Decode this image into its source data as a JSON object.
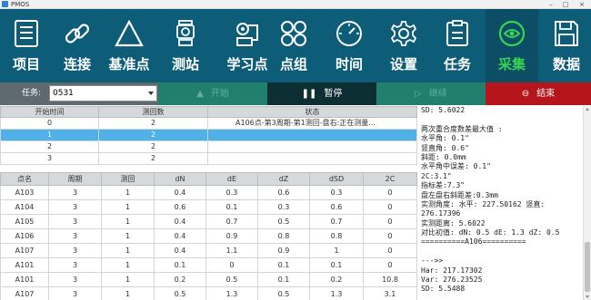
{
  "window": {
    "title": "PMOS"
  },
  "toolbar": {
    "items": [
      {
        "label": "项目",
        "icon": "list-icon"
      },
      {
        "label": "连接",
        "icon": "link-icon"
      },
      {
        "label": "基准点",
        "icon": "triangle-icon"
      },
      {
        "label": "测站",
        "icon": "total-station-icon"
      },
      {
        "label": "学习点",
        "icon": "learn-point-icon"
      },
      {
        "label": "点组",
        "icon": "point-group-icon"
      },
      {
        "label": "时间",
        "icon": "clock-icon"
      },
      {
        "label": "设置",
        "icon": "gear-icon"
      },
      {
        "label": "任务",
        "icon": "task-icon"
      },
      {
        "label": "采集",
        "icon": "collect-icon"
      },
      {
        "label": "数据",
        "icon": "save-icon"
      }
    ],
    "active_index": 9,
    "colors": {
      "background": "#0d5c78",
      "active_label": "#39d353"
    }
  },
  "controls": {
    "task_label": "任务:",
    "task_value": "0531",
    "start_label": "开始",
    "pause_label": "暂停",
    "continue_label": "继续",
    "end_label": "结束"
  },
  "rounds_table": {
    "headers": [
      "开始时间",
      "测回数",
      "状态"
    ],
    "rows": [
      [
        "0",
        "2",
        "A106点-第3周期-第1测回-盘右:正在测量..."
      ],
      [
        "1",
        "2",
        ""
      ],
      [
        "2",
        "2",
        ""
      ],
      [
        "3",
        "2",
        ""
      ]
    ],
    "selected_row": 1
  },
  "points_table": {
    "headers": [
      "点名",
      "周期",
      "测回",
      "dN",
      "dE",
      "dZ",
      "dSD",
      "2C"
    ],
    "rows": [
      [
        "A103",
        "3",
        "1",
        "0.4",
        "0.3",
        "0.6",
        "0.3",
        "0"
      ],
      [
        "A104",
        "3",
        "1",
        "0.6",
        "0.1",
        "0.3",
        "0.6",
        "0"
      ],
      [
        "A105",
        "3",
        "1",
        "0.4",
        "0.7",
        "0.5",
        "0.7",
        "0"
      ],
      [
        "A106",
        "3",
        "1",
        "0.4",
        "0.9",
        "0.8",
        "0.8",
        "0"
      ],
      [
        "A107",
        "3",
        "1",
        "0.4",
        "1.1",
        "0.9",
        "1",
        "0"
      ],
      [
        "A101",
        "3",
        "1",
        "0.1",
        "0",
        "0.1",
        "0.1",
        "0"
      ],
      [
        "A101",
        "3",
        "1",
        "0.2",
        "0.5",
        "0.1",
        "0.2",
        "10.8"
      ],
      [
        "A107",
        "3",
        "1",
        "0.5",
        "1.3",
        "0.5",
        "1.3",
        "3.1"
      ]
    ]
  },
  "log": {
    "lines": [
      "SD: 5.6022",
      "",
      "两次重合度数差最大值 :",
      "水平角: 0.1\"",
      "竖直角: 0.6\"",
      "斜距: 0.0mm",
      "水平角中误差: 0.1\"",
      "2C:3.1\"",
      "指标差:7.3\"",
      "盘左盘右斜距差:0.3mm",
      "实测角度: 水平: 227.50162 竖直:",
      "276.17396",
      "实测距离: 5.6022",
      "对比初值: dN: 0.5 dE: 1.3 dZ: 0.5",
      "==========A106==========",
      "",
      "--->>",
      "Har: 217.17302",
      "Var: 276.23525",
      "SD: 5.5488"
    ]
  }
}
